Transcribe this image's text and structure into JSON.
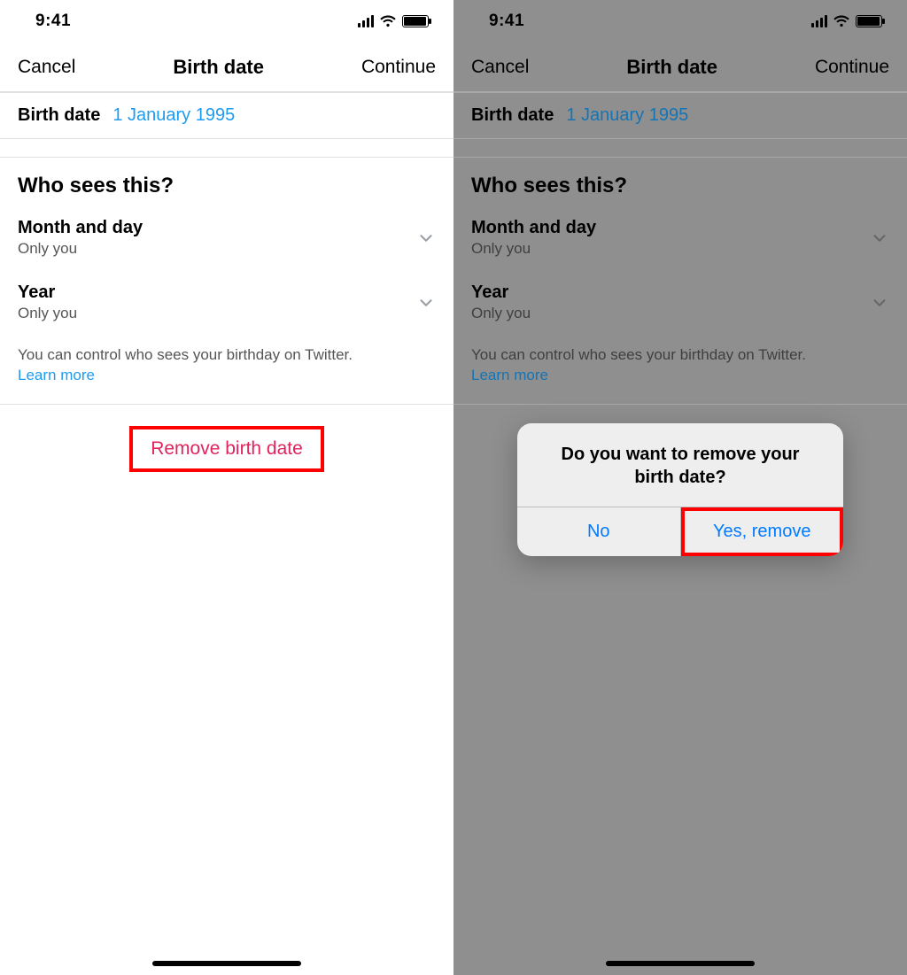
{
  "status": {
    "time": "9:41"
  },
  "nav": {
    "left": "Cancel",
    "title": "Birth date",
    "right": "Continue"
  },
  "birth": {
    "label": "Birth date",
    "value": "1 January 1995"
  },
  "who": {
    "title": "Who sees this?",
    "monthday": {
      "label": "Month and day",
      "value": "Only you"
    },
    "year": {
      "label": "Year",
      "value": "Only you"
    },
    "info_text": "You can control who sees your birthday on Twitter.",
    "learn_more": "Learn more"
  },
  "remove": {
    "label": "Remove birth date"
  },
  "alert": {
    "title": "Do you want to remove your birth date?",
    "no": "No",
    "yes": "Yes, remove"
  }
}
